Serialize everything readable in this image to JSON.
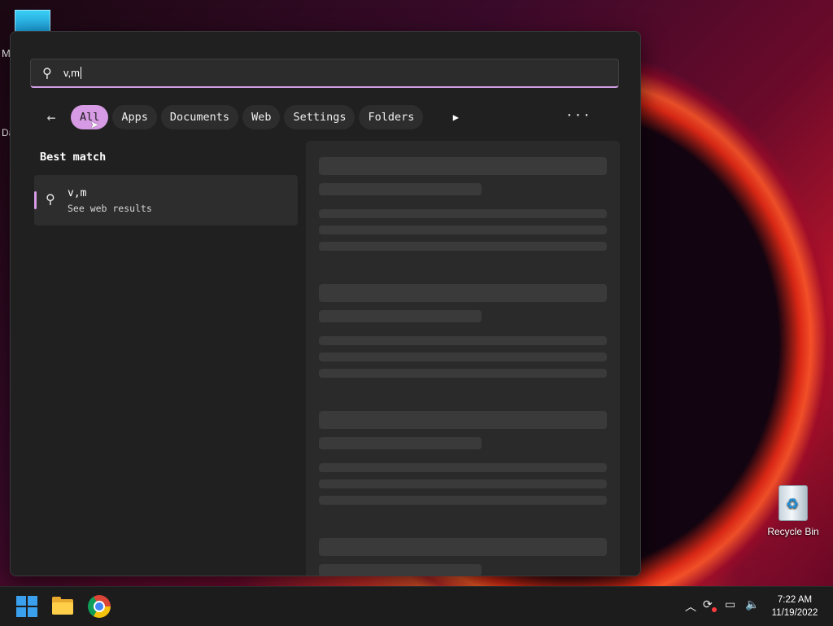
{
  "desktop": {
    "edge_letters": [
      "M",
      "Da"
    ],
    "recycle_bin_label": "Recycle Bin"
  },
  "search": {
    "query": "v,m",
    "filters": [
      {
        "label": "All",
        "active": true
      },
      {
        "label": "Apps",
        "active": false
      },
      {
        "label": "Documents",
        "active": false
      },
      {
        "label": "Web",
        "active": false
      },
      {
        "label": "Settings",
        "active": false
      },
      {
        "label": "Folders",
        "active": false
      }
    ],
    "icons": {
      "back": "back-arrow-icon",
      "more_filters": "play-icon",
      "more": "more-options-icon",
      "search": "search-icon"
    }
  },
  "best_match": {
    "heading": "Best match",
    "item_title": "v,m",
    "item_subtitle": "See web results"
  },
  "taskbar": {
    "apps": [
      "start",
      "file-explorer",
      "chrome"
    ],
    "time": "7:22 AM",
    "date": "11/19/2022"
  },
  "colors": {
    "accent": "#d69be4",
    "panel": "#202020",
    "taskbar": "#1c1c1c"
  }
}
